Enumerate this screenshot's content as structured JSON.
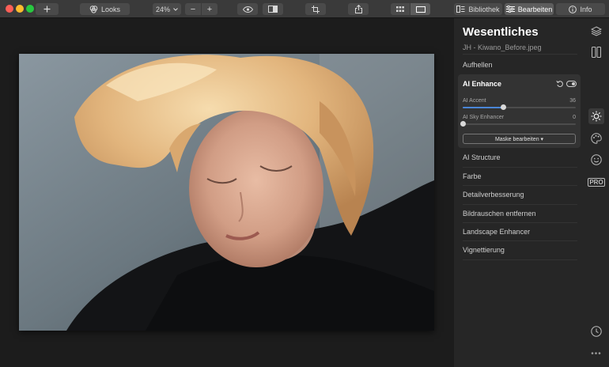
{
  "toolbar": {
    "add_icon": "plus-icon",
    "looks_label": "Looks",
    "zoom_value": "24%",
    "zoom_out_symbol": "−",
    "zoom_in_symbol": "+",
    "bibliothek_label": "Bibliothek",
    "bearbeiten_label": "Bearbeiten",
    "info_label": "Info"
  },
  "panel": {
    "title": "Wesentliches",
    "file_name": "JH - Kiwano_Before.jpeg",
    "sections_top": [
      "Aufhellen"
    ],
    "ai_enhance": {
      "title": "AI Enhance",
      "sliders": [
        {
          "label": "AI Accent",
          "value": "36",
          "fraction": 0.36
        },
        {
          "label": "AI Sky Enhancer",
          "value": "0",
          "fraction": 0
        }
      ],
      "mask_button": "Maske bearbeiten ▾"
    },
    "sections_bottom": [
      "AI Structure",
      "Farbe",
      "Detailverbesserung",
      "Bildrauschen entfernen",
      "Landscape Enhancer",
      "Vignettierung"
    ]
  },
  "rail": {
    "pro_label": "PRO",
    "more_label": "•••"
  },
  "colors": {
    "accent": "#4a86d6",
    "panel_bg": "#262626",
    "canvas_bg": "#1c1c1c"
  }
}
